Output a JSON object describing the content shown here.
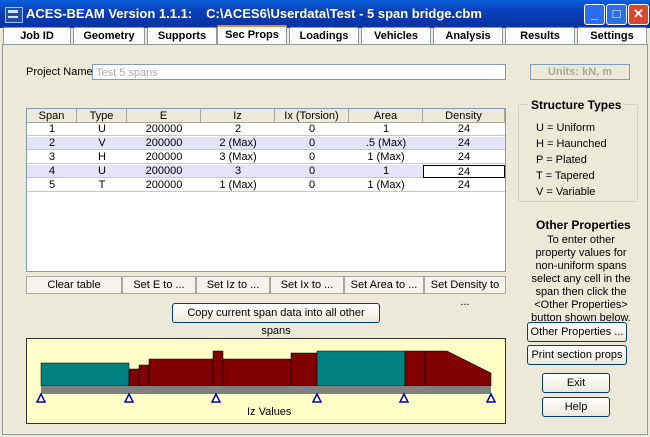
{
  "window": {
    "app": "ACES-BEAM Version 1.1.1:",
    "path": "C:\\ACES6\\Userdata\\Test - 5 span bridge.cbm"
  },
  "tabs": [
    "Job ID",
    "Geometry",
    "Supports",
    "Sec Props",
    "Loadings",
    "Vehicles",
    "Analysis",
    "Results",
    "Settings"
  ],
  "active_tab": "Sec Props",
  "project": {
    "label": "Project Name:",
    "value": "Test 5 spans"
  },
  "units": "Units: kN, m",
  "table": {
    "headers": [
      "Span",
      "Type",
      "E",
      "Iz",
      "Ix (Torsion)",
      "Area",
      "Density"
    ],
    "rows": [
      [
        "1",
        "U",
        "200000",
        "2",
        "0",
        "1",
        "24"
      ],
      [
        "2",
        "V",
        "200000",
        "2 (Max)",
        "0",
        ".5 (Max)",
        "24"
      ],
      [
        "3",
        "H",
        "200000",
        "3 (Max)",
        "0",
        "1 (Max)",
        "24"
      ],
      [
        "4",
        "U",
        "200000",
        "3",
        "0",
        "1",
        "24"
      ],
      [
        "5",
        "T",
        "200000",
        "1 (Max)",
        "0",
        "1 (Max)",
        "24"
      ]
    ]
  },
  "table_buttons": [
    "Clear table",
    "Set E to ...",
    "Set Iz to ...",
    "Set Ix to ...",
    "Set Area to ...",
    "Set Density to ..."
  ],
  "copy_button": "Copy current span data into all other spans",
  "structure_types": {
    "title": "Structure Types",
    "items": [
      "U  =  Uniform",
      "H  =  Haunched",
      "P  =  Plated",
      "T  =  Tapered",
      "V  =  Variable"
    ]
  },
  "other_properties": {
    "title": "Other Properties",
    "text": "To enter other property values for non-uniform spans select any cell in the span then click the <Other Properties> button shown below."
  },
  "buttons": {
    "other_props": "Other Properties ...",
    "print": "Print section props",
    "exit": "Exit",
    "help": "Help"
  },
  "diagram": {
    "label": "Iz Values",
    "colors": {
      "uniform": "#008080",
      "other": "#800000",
      "deck": "#808080",
      "support": "#0000c0"
    }
  }
}
